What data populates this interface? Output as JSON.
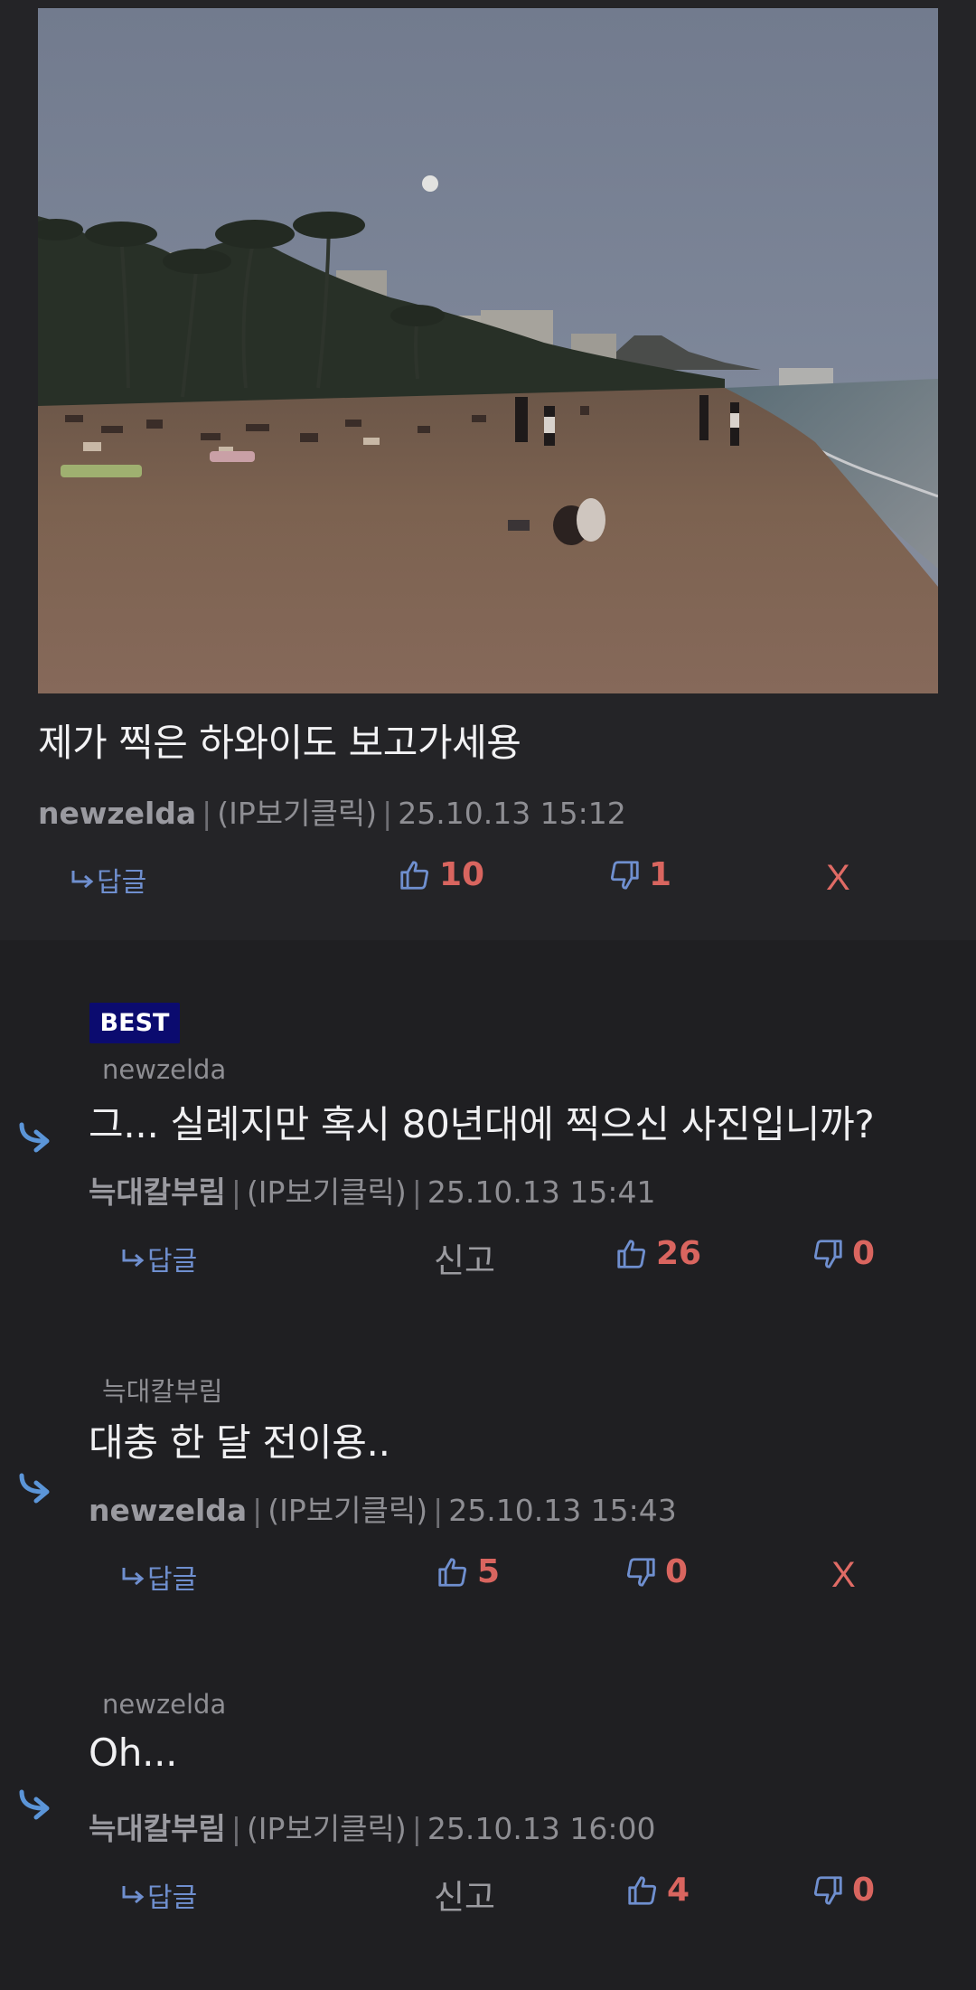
{
  "post": {
    "title": "제가 찍은 하와이도 보고가세용",
    "author": "newzelda",
    "ip_label": "(IP보기클릭)",
    "datetime": "25.10.13 15:12",
    "reply_label": "답글",
    "upvotes": "10",
    "downvotes": "1",
    "delete_label": "X"
  },
  "comments": [
    {
      "badge": "BEST",
      "reply_to": "newzelda",
      "text": "그... 실례지만 혹시 80년대에 찍으신 사진입니까?",
      "author": "늑대칼부림",
      "ip_label": "(IP보기클릭)",
      "datetime": "25.10.13 15:41",
      "reply_label": "답글",
      "report_label": "신고",
      "upvotes": "26",
      "downvotes": "0"
    },
    {
      "reply_to": "늑대칼부림",
      "text": "대충 한 달 전이용..",
      "author": "newzelda",
      "ip_label": "(IP보기클릭)",
      "datetime": "25.10.13 15:43",
      "reply_label": "답글",
      "upvotes": "5",
      "downvotes": "0",
      "delete_label": "X"
    },
    {
      "reply_to": "newzelda",
      "text": "Oh...",
      "author": "늑대칼부림",
      "ip_label": "(IP보기클릭)",
      "datetime": "25.10.13 16:00",
      "reply_label": "답글",
      "report_label": "신고",
      "upvotes": "4",
      "downvotes": "0"
    }
  ],
  "colors": {
    "background": "#1f1f22",
    "accent_blue": "#6f8fcf",
    "vote_red": "#d9655f",
    "best_badge": "#0b0b6f"
  },
  "icons": {
    "reply": "reply-arrow-icon",
    "upvote": "thumbs-up-icon",
    "downvote": "thumbs-down-icon",
    "comment_indent": "comment-reply-arrow-icon"
  }
}
